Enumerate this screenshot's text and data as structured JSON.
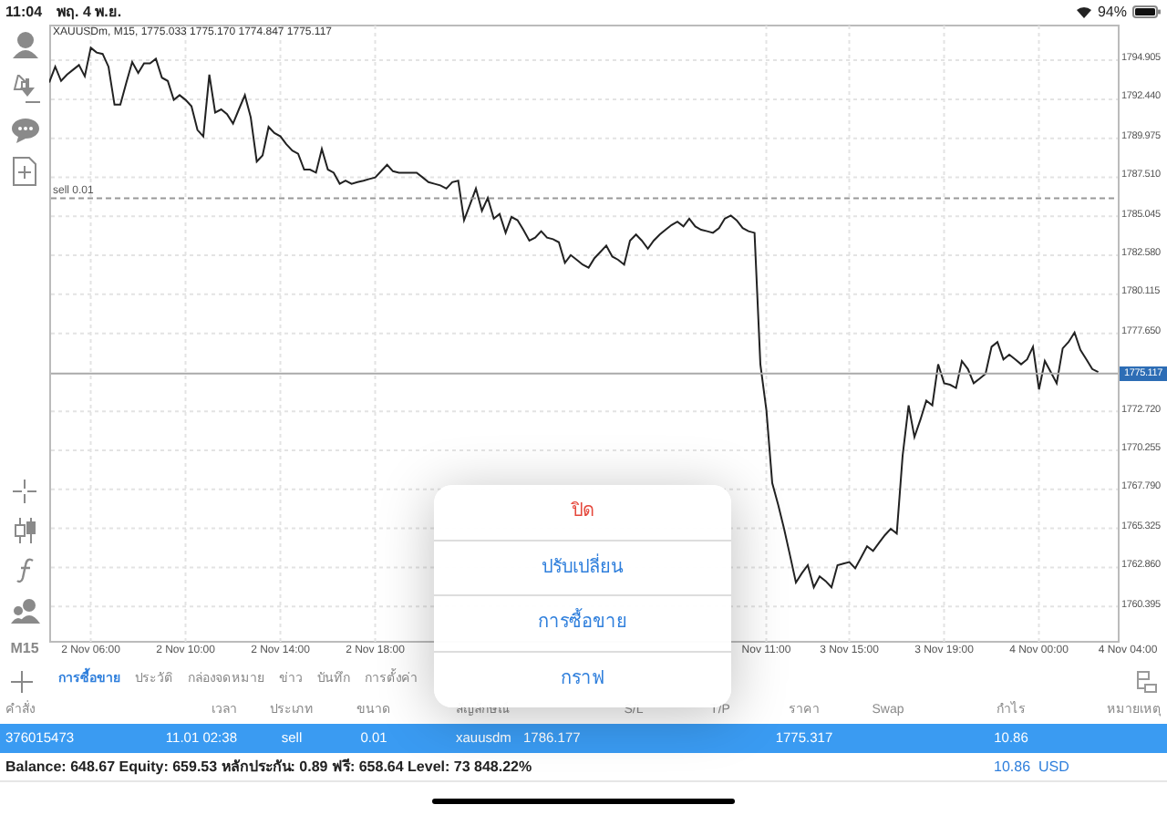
{
  "status_bar": {
    "time": "11:04",
    "date": "พฤ. 4 พ.ย.",
    "battery_text": "94%"
  },
  "toolbar": {
    "timeframe": "M15"
  },
  "chart": {
    "chart_data": {
      "type": "line",
      "title": "XAUUSDm, M15, 1775.033 1775.170 1774.847 1775.117",
      "categories": [
        null,
        null,
        null,
        null,
        null,
        null,
        null,
        "2 Nov 06:00",
        null,
        null,
        null,
        null,
        null,
        null,
        null,
        null,
        null,
        null,
        null,
        null,
        null,
        null,
        null,
        "2 Nov 10:00",
        null,
        null,
        null,
        null,
        null,
        null,
        null,
        null,
        null,
        null,
        null,
        null,
        null,
        null,
        null,
        "2 Nov 14:00",
        null,
        null,
        null,
        null,
        null,
        null,
        null,
        null,
        null,
        null,
        null,
        null,
        null,
        null,
        null,
        "2 Nov 18:00",
        null,
        null,
        null,
        null,
        null,
        null,
        null,
        null,
        null,
        null,
        null,
        null,
        null,
        null,
        null,
        null,
        null,
        null,
        null,
        null,
        null,
        null,
        null,
        null,
        null,
        null,
        null,
        null,
        null,
        null,
        null,
        null,
        null,
        null,
        null,
        null,
        null,
        null,
        null,
        null,
        null,
        null,
        null,
        null,
        null,
        null,
        null,
        null,
        null,
        null,
        null,
        null,
        null,
        null,
        null,
        null,
        null,
        null,
        null,
        null,
        null,
        null,
        null,
        null,
        null,
        "Nov 11:00",
        null,
        null,
        null,
        null,
        null,
        null,
        null,
        null,
        null,
        null,
        null,
        null,
        null,
        "3 Nov 15:00",
        null,
        null,
        null,
        null,
        null,
        null,
        null,
        null,
        null,
        null,
        null,
        null,
        null,
        null,
        null,
        "3 Nov 19:00",
        null,
        null,
        null,
        null,
        null,
        null,
        null,
        null,
        null,
        null,
        null,
        null,
        null,
        null,
        null,
        "4 Nov 00:00",
        null,
        null,
        null,
        null,
        null,
        null,
        null,
        null,
        null,
        null,
        null,
        null,
        null,
        null,
        "4 Nov 04:00"
      ],
      "series": [
        {
          "color": "#222222",
          "values": [
            1793.5,
            1794.5,
            1793.6,
            1794.0,
            1794.3,
            1794.6,
            1793.9,
            1795.7,
            1795.4,
            1795.3,
            1794.5,
            1792.1,
            1792.1,
            1793.5,
            1794.8,
            1794.1,
            1794.7,
            1794.7,
            1795.0,
            1793.8,
            1793.6,
            1792.4,
            1792.7,
            1792.4,
            1792.0,
            1790.5,
            1790.1,
            1794.0,
            1791.6,
            1791.8,
            1791.5,
            1790.9,
            1791.8,
            1792.7,
            1791.3,
            1788.5,
            1788.9,
            1790.7,
            1790.3,
            1790.1,
            1789.6,
            1789.2,
            1789.0,
            1788.0,
            1788.0,
            1787.8,
            1789.3,
            1788.0,
            1787.8,
            1787.1,
            1787.3,
            1787.1,
            1787.2,
            1787.3,
            1787.4,
            1787.5,
            1787.9,
            1788.3,
            1787.9,
            1787.8,
            1787.8,
            1787.8,
            1787.8,
            1787.5,
            1787.2,
            1787.1,
            1787.0,
            1786.8,
            1787.2,
            1787.3,
            1784.8,
            1785.8,
            1786.8,
            1785.4,
            1786.2,
            1784.9,
            1785.2,
            1784.0,
            1785.0,
            1784.8,
            1784.2,
            1783.5,
            1783.7,
            1784.1,
            1783.7,
            1783.6,
            1783.4,
            1782.1,
            1782.6,
            1782.3,
            1782.0,
            1781.8,
            1782.4,
            1782.8,
            1783.2,
            1782.5,
            1782.3,
            1782.0,
            1783.5,
            1783.9,
            1783.5,
            1783.0,
            1783.5,
            1783.9,
            1784.2,
            1784.5,
            1784.7,
            1784.4,
            1784.9,
            1784.4,
            1784.2,
            1784.1,
            1784.0,
            1784.3,
            1784.9,
            1785.1,
            1784.8,
            1784.3,
            1784.1,
            1784.0,
            1775.7,
            1772.8,
            1768.2,
            1766.8,
            1765.3,
            1763.6,
            1761.9,
            1762.5,
            1763.0,
            1761.6,
            1762.3,
            1762.0,
            1761.6,
            1763.0,
            1763.1,
            1763.2,
            1762.8,
            1763.5,
            1764.2,
            1763.9,
            1764.4,
            1764.9,
            1765.3,
            1765.0,
            1769.9,
            1773.1,
            1771.1,
            1772.2,
            1773.4,
            1773.1,
            1775.7,
            1774.5,
            1774.4,
            1774.2,
            1775.9,
            1775.4,
            1774.5,
            1774.8,
            1775.1,
            1776.8,
            1777.1,
            1776.0,
            1776.3,
            1776.0,
            1775.7,
            1776.0,
            1776.8,
            1774.1,
            1775.9,
            1775.2,
            1774.5,
            1776.7,
            1777.1,
            1777.7,
            1776.6,
            1776.0,
            1775.4,
            1775.2,
            null,
            null,
            null,
            null,
            null
          ]
        }
      ],
      "ylim": [
        1758.16,
        1797.1
      ],
      "yticks": [
        {
          "value": 1794.905,
          "label": "1794.905"
        },
        {
          "value": 1792.44,
          "label": "1792.440"
        },
        {
          "value": 1789.975,
          "label": "1789.975"
        },
        {
          "value": 1787.51,
          "label": "1787.510"
        },
        {
          "value": 1785.045,
          "label": "1785.045"
        },
        {
          "value": 1782.58,
          "label": "1782.580"
        },
        {
          "value": 1780.115,
          "label": "1780.115"
        },
        {
          "value": 1777.65,
          "label": "1777.650"
        },
        {
          "value": 1772.72,
          "label": "1772.720"
        },
        {
          "value": 1770.255,
          "label": "1770.255"
        },
        {
          "value": 1767.79,
          "label": "1767.790"
        },
        {
          "value": 1765.325,
          "label": "1765.325"
        },
        {
          "value": 1762.86,
          "label": "1762.860"
        },
        {
          "value": 1760.395,
          "label": "1760.395"
        }
      ],
      "grid": true,
      "ref_lines": [
        {
          "axis": "y",
          "value": 1786.177,
          "label": "sell 0.01"
        },
        {
          "axis": "y",
          "value": 1775.117,
          "label": "1775.117"
        }
      ]
    }
  },
  "tabs": [
    {
      "label": "การซื้อขาย",
      "selected": true
    },
    {
      "label": "ประวัติ",
      "selected": false
    },
    {
      "label": "กล่องจดหมาย",
      "selected": false
    },
    {
      "label": "ข่าว",
      "selected": false
    },
    {
      "label": "บันทึก",
      "selected": false
    },
    {
      "label": "การตั้งค่า",
      "selected": false
    }
  ],
  "table": {
    "columns": [
      "คำสั่ง",
      "เวลา",
      "ประเภท",
      "ขนาด",
      "สัญลักษณ์",
      "",
      "S/L",
      "T/P",
      "ราคา",
      "Swap",
      "กำไร",
      "หมายเหตุ"
    ],
    "rows": [
      {
        "selected": true,
        "cells": [
          "376015473",
          "11.01 02:38",
          "sell",
          "0.01",
          "xauusdm",
          "1786.177",
          "",
          "",
          "1775.317",
          "",
          "10.86",
          ""
        ]
      }
    ]
  },
  "summary": {
    "text": "Balance: 648.67 Equity: 659.53 หลักประกัน: 0.89 ฟรี: 658.64 Level: 73 848.22%",
    "total": "10.86  USD"
  },
  "popup_menu": [
    {
      "label": "ปิด",
      "kind": "destructive"
    },
    {
      "label": "ปรับเปลี่ยน",
      "kind": "normal"
    },
    {
      "label": "การซื้อขาย",
      "kind": "normal"
    },
    {
      "label": "กราฟ",
      "kind": "normal"
    }
  ]
}
